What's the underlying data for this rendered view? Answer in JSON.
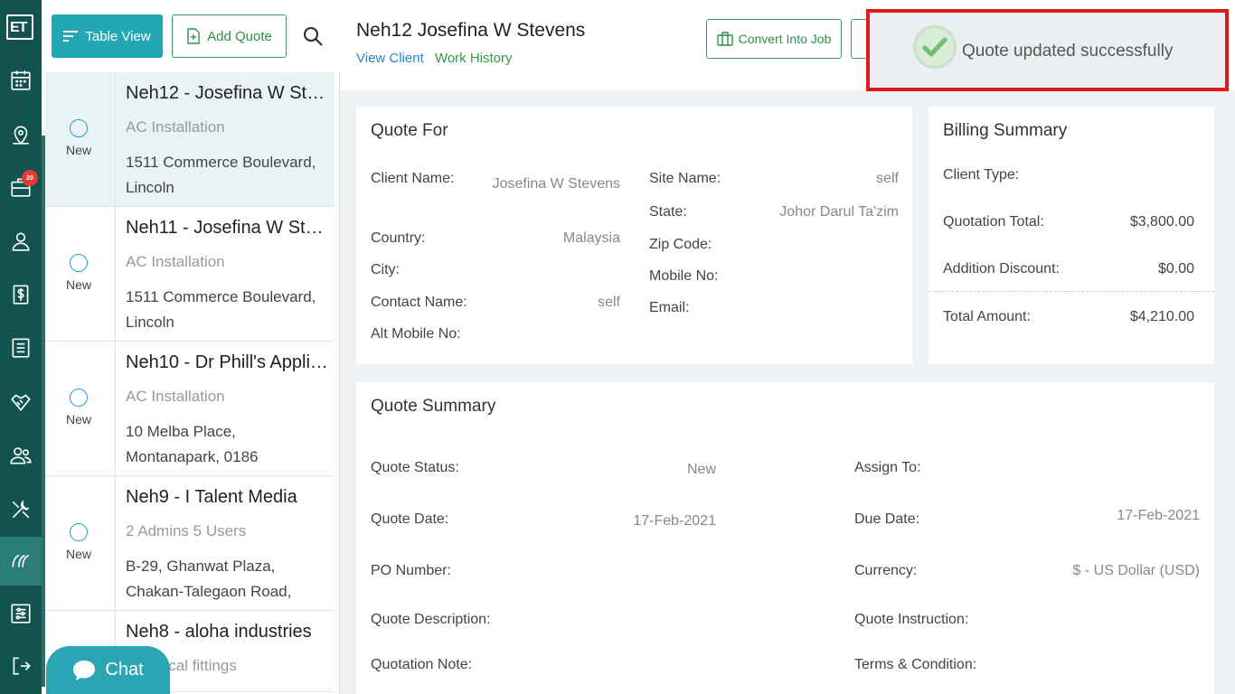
{
  "rail": {
    "logo": "ET",
    "badge": "20"
  },
  "list": {
    "table_view_label": "Table View",
    "add_quote_label": "Add Quote",
    "items": [
      {
        "title": "Neh12 - Josefina W Stev...",
        "type": "AC Installation",
        "address": "1511 Commerce Boulevard, Lincoln",
        "status": "New"
      },
      {
        "title": "Neh11 - Josefina W Stev...",
        "type": "AC Installation",
        "address": "1511 Commerce Boulevard, Lincoln",
        "status": "New"
      },
      {
        "title": "Neh10 - Dr Phill's Applia...",
        "type": "AC Installation",
        "address": "10 Melba Place, Montanapark, 0186",
        "status": "New"
      },
      {
        "title": "Neh9 - I Talent Media",
        "type": "2 Admins 5 Users",
        "address": "B-29, Ghanwat Plaza, Chakan-Talegaon Road, Chakan-...",
        "status": "New"
      },
      {
        "title": "Neh8 - aloha industries",
        "type": "Electrical fittings",
        "address": "",
        "status": ""
      }
    ]
  },
  "chat_label": "Chat",
  "header": {
    "title": "Neh12 Josefina W Stevens",
    "view_client": "View Client",
    "work_history": "Work History",
    "convert_label": "Convert Into Job"
  },
  "toast": {
    "message": "Quote updated successfully"
  },
  "quote_for": {
    "heading": "Quote For",
    "client_name_label": "Client Name:",
    "client_name_value": "Josefina W Stevens",
    "country_label": "Country:",
    "country_value": "Malaysia",
    "city_label": "City:",
    "contact_name_label": "Contact Name:",
    "contact_name_value": "self",
    "alt_mobile_label": "Alt Mobile No:",
    "site_name_label": "Site Name:",
    "site_name_value": "self",
    "state_label": "State:",
    "state_value": "Johor Darul Ta'zim",
    "zip_label": "Zip Code:",
    "mobile_label": "Mobile No:",
    "email_label": "Email:"
  },
  "billing": {
    "heading": "Billing Summary",
    "client_type_label": "Client Type:",
    "quotation_total_label": "Quotation Total:",
    "quotation_total_value": "$3,800.00",
    "discount_label": "Addition Discount:",
    "discount_value": "$0.00",
    "total_label": "Total Amount:",
    "total_value": "$4,210.00"
  },
  "summary": {
    "heading": "Quote Summary",
    "status_label": "Quote Status:",
    "status_value": "New",
    "date_label": "Quote Date:",
    "date_value": "17-Feb-2021",
    "po_label": "PO Number:",
    "description_label": "Quote Description:",
    "note_label": "Quotation Note:",
    "assign_label": "Assign To:",
    "due_label": "Due Date:",
    "due_value": "17-Feb-2021",
    "currency_label": "Currency:",
    "currency_value": "$ - US Dollar (USD)",
    "instruction_label": "Quote Instruction:",
    "terms_label": "Terms & Condition:"
  }
}
